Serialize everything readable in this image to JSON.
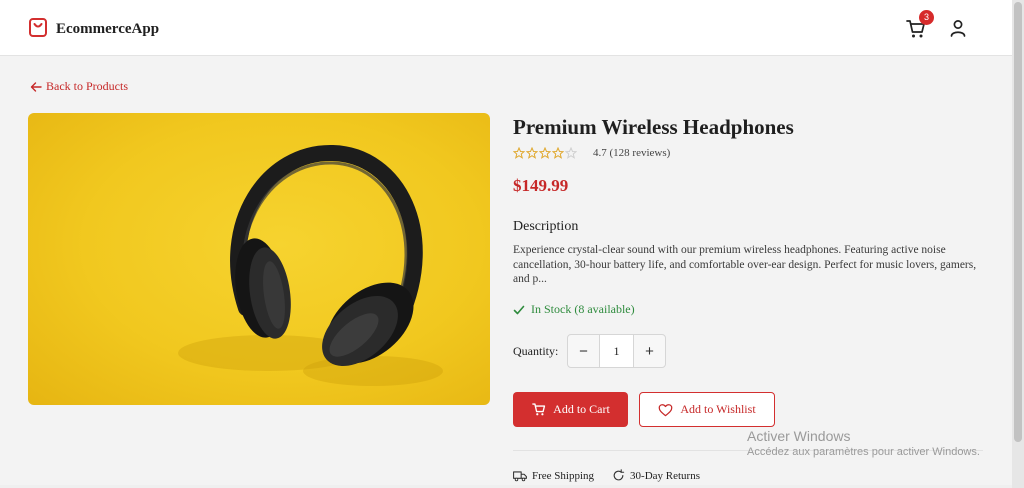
{
  "header": {
    "brand_name": "EcommerceApp",
    "cart_count": "3"
  },
  "nav": {
    "back_label": "Back to Products"
  },
  "product": {
    "title": "Premium Wireless Headphones",
    "rating": 4.7,
    "rating_text": "4.7 (128 reviews)",
    "price": "$149.99",
    "description_heading": "Description",
    "description": "Experience crystal-clear sound with our premium wireless headphones. Featuring active noise cancellation, 30-hour battery life, and comfortable over-ear design. Perfect for music lovers, gamers, and p...",
    "stock_text": "In Stock (8 available)"
  },
  "quantity": {
    "label": "Quantity:",
    "value": "1",
    "decrement": "−",
    "increment": "+"
  },
  "actions": {
    "add_to_cart": "Add to Cart",
    "add_to_wishlist": "Add to Wishlist"
  },
  "features": {
    "shipping": "Free Shipping",
    "returns": "30-Day Returns"
  },
  "watermark": {
    "line1": "Activer Windows",
    "line2": "Accédez aux paramètres pour activer Windows."
  },
  "colors": {
    "accent": "#d32f2f",
    "stock": "#2e8b3d",
    "star": "#e0a82e",
    "image_bg": "#f1c81f"
  }
}
